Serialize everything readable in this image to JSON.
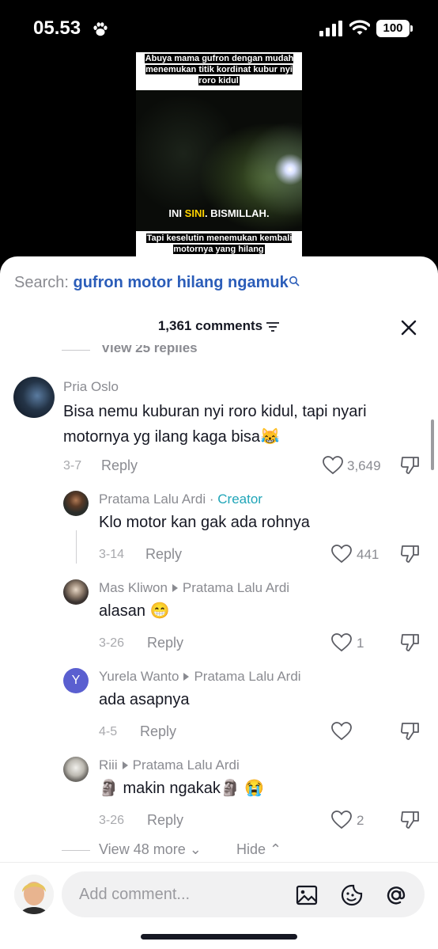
{
  "status_bar": {
    "time": "05.53",
    "battery": "100"
  },
  "video": {
    "caption_top": "Abuya mama gufron dengan mudah menemukan titik kordinat kubur nyi roro kidul",
    "subtitle_a": "INI ",
    "subtitle_b": "SINI",
    "subtitle_c": ". BISMILLAH.",
    "caption_bottom": "Tapi keselutin menemukan kembali motornya yang hilang"
  },
  "search": {
    "label": "Search:",
    "query": "gufron motor hilang ngamuk"
  },
  "header": {
    "count": "1,361 comments"
  },
  "partial_replies": "View 25 replies",
  "comments": [
    {
      "name": "Pria Oslo",
      "text_1": "Bisa nemu kuburan nyi roro kidul, tapi nyari",
      "text_2": "motornya yg ilang kaga bisa😹",
      "date": "3-7",
      "reply": "Reply",
      "likes": "3,649"
    },
    {
      "name": "Pratama Lalu Ardi",
      "sep": "·",
      "badge": "Creator",
      "text": "Klo motor kan gak ada rohnya",
      "date": "3-14",
      "reply": "Reply",
      "likes": "441"
    },
    {
      "name": "Mas Kliwon",
      "to": "Pratama Lalu Ardi",
      "text": "alasan 😁",
      "date": "3-26",
      "reply": "Reply",
      "likes": "1"
    },
    {
      "name": "Yurela Wanto",
      "avatar_letter": "Y",
      "to": "Pratama Lalu Ardi",
      "text": "ada asapnya",
      "date": "4-5",
      "reply": "Reply",
      "likes": ""
    },
    {
      "name": "Riii",
      "to": "Pratama Lalu Ardi",
      "text": "🗿 makin ngakak🗿 😭",
      "date": "3-26",
      "reply": "Reply",
      "likes": "2"
    }
  ],
  "footer_links": {
    "view_more": "View 48 more",
    "hide": "Hide"
  },
  "composer": {
    "placeholder": "Add comment..."
  },
  "colors": {
    "creator": "#20a5b8",
    "query": "#2b5db9",
    "avatar_y": "#5a5fd0"
  }
}
